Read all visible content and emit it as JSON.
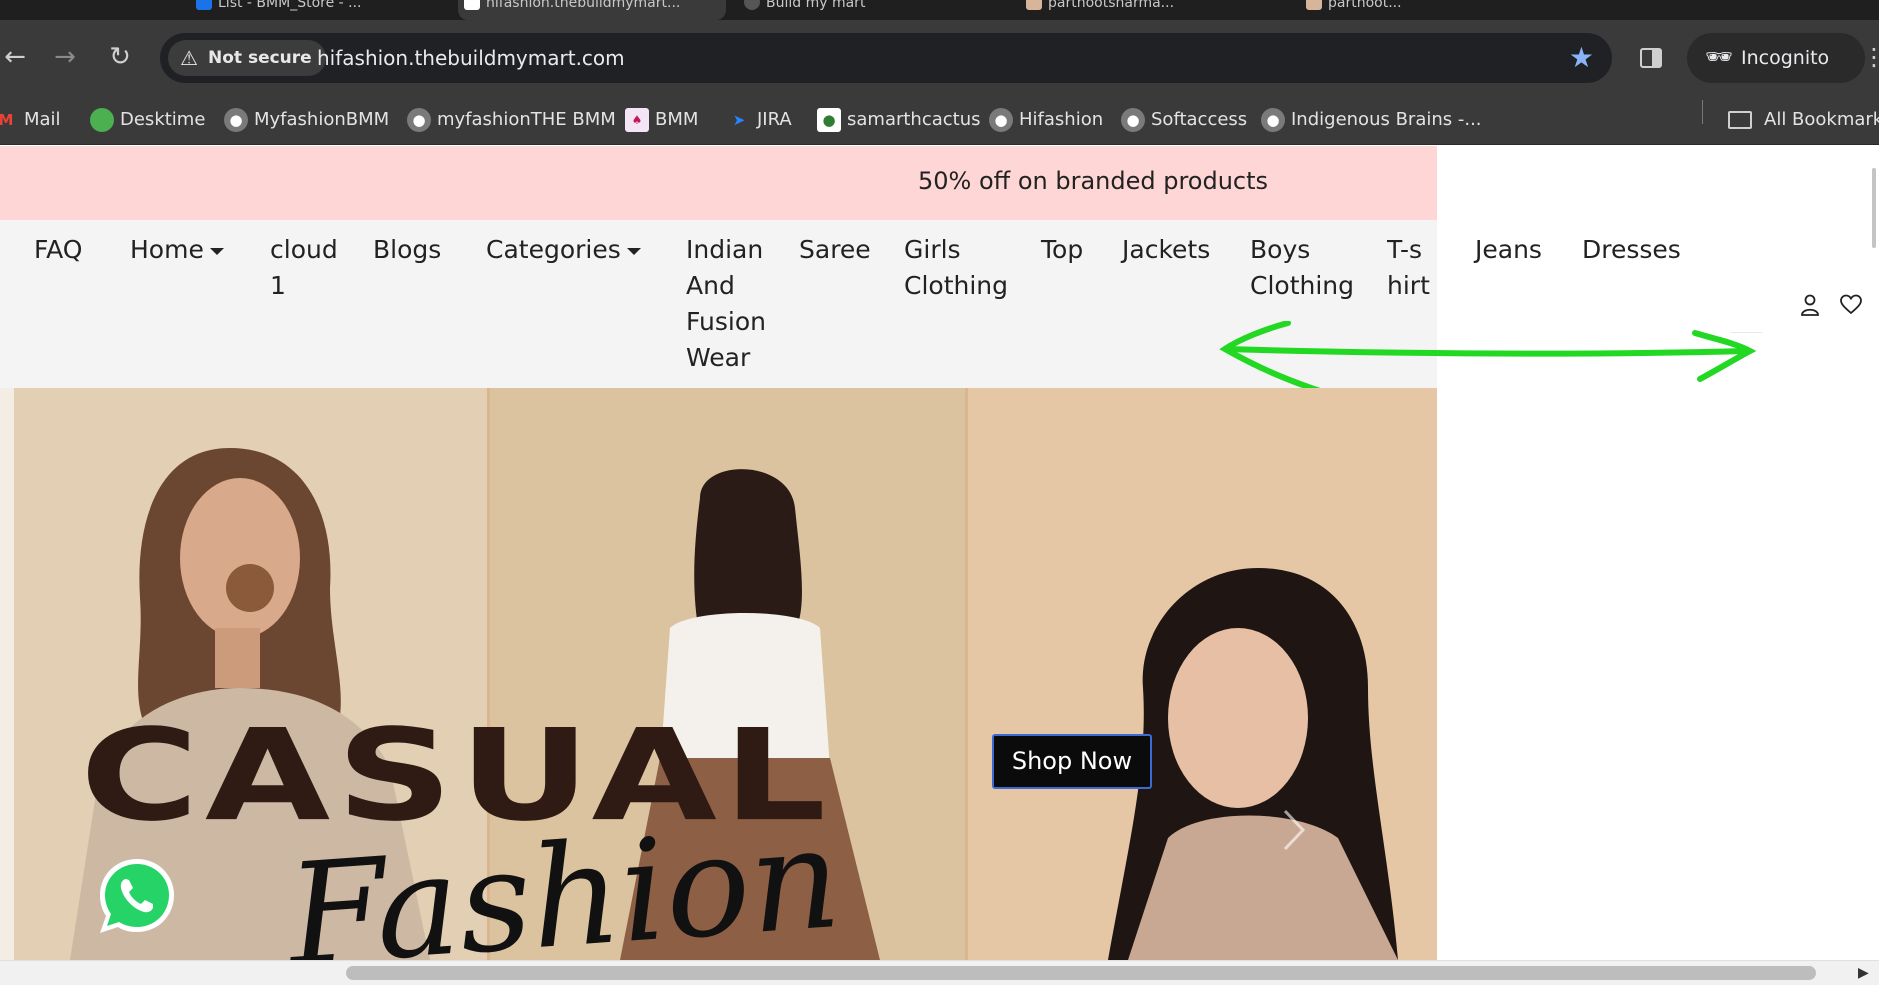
{
  "browser": {
    "tabs": [
      {
        "title": "List - BMM_Store - ..."
      },
      {
        "title": "hifashion.thebuildmymart..."
      },
      {
        "title": "Build my mart"
      },
      {
        "title": "parthootsharma..."
      },
      {
        "title": "parthoot..."
      }
    ],
    "security_label": "Not secure",
    "url": "hifashion.thebuildmymart.com",
    "incognito_label": "Incognito",
    "bookmarks": [
      {
        "label": "Mail",
        "icon": "gmail-icon",
        "color": "#ea4335"
      },
      {
        "label": "Desktime",
        "icon": "desktime-icon",
        "color": "#4caf50"
      },
      {
        "label": "MyfashionBMM",
        "icon": "globe-icon",
        "color": "#9e9e9e"
      },
      {
        "label": "myfashionTHE BMM",
        "icon": "globe-icon",
        "color": "#9e9e9e"
      },
      {
        "label": "BMM",
        "icon": "bmm-icon",
        "color": "#c2185b"
      },
      {
        "label": "JIRA",
        "icon": "jira-icon",
        "color": "#2684ff"
      },
      {
        "label": "samarthcactus",
        "icon": "cactus-icon",
        "color": "#2e7d32"
      },
      {
        "label": "Hifashion",
        "icon": "globe-icon",
        "color": "#9e9e9e"
      },
      {
        "label": "Softaccess",
        "icon": "globe-icon",
        "color": "#9e9e9e"
      },
      {
        "label": "Indigenous Brains -...",
        "icon": "globe-icon",
        "color": "#9e9e9e"
      }
    ],
    "all_bookmarks_label": "All Bookmarks"
  },
  "promo": {
    "text": "50% off on branded products",
    "bg": "#ffd6d6"
  },
  "menu": {
    "items": [
      {
        "label": "FAQ"
      },
      {
        "label": "Home",
        "dropdown": true
      },
      {
        "label": "cloud 1"
      },
      {
        "label": "Blogs"
      },
      {
        "label": "Categories",
        "dropdown": true
      },
      {
        "label": "Indian And Fusion Wear"
      },
      {
        "label": "Saree"
      },
      {
        "label": "Girls Clothing"
      },
      {
        "label": "Top"
      },
      {
        "label": "Jackets"
      },
      {
        "label": "Boys Clothing"
      },
      {
        "label": "T-shirt"
      },
      {
        "label": "Jeans"
      },
      {
        "label": "Dresses"
      }
    ]
  },
  "hero": {
    "title_main": "CASUAL",
    "title_script": "Fashion",
    "cta": "Shop Now"
  },
  "annotation": {
    "color": "#22d822"
  }
}
